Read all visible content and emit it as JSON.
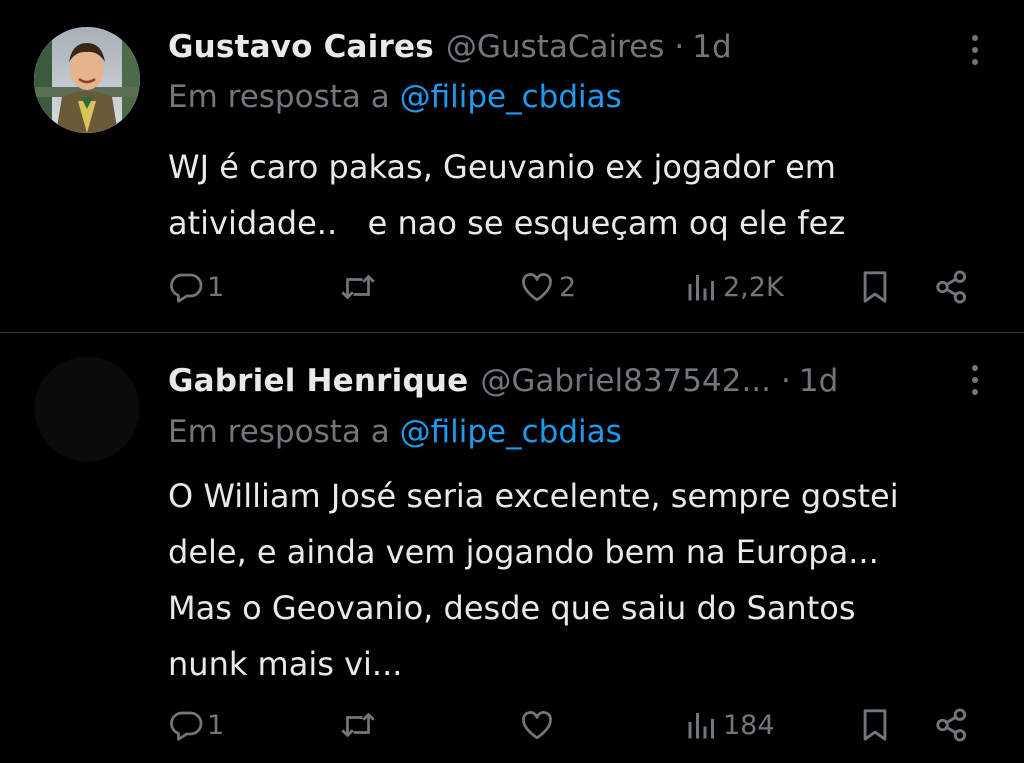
{
  "theme": {
    "background": "#000000",
    "text_primary": "#e7e9ea",
    "text_secondary": "#71767b",
    "link": "#1d9bf0",
    "divider": "#2f3336"
  },
  "tweets": [
    {
      "author_name": "Gustavo Caires",
      "handle": "@GustaCaires",
      "separator": "·",
      "time": "1d",
      "reply_prefix": "Em resposta a",
      "reply_to": "@filipe_cbdias",
      "text_lines": [
        "WJ é caro pakas, Geuvanio ex jogador em",
        "atividade..   e nao se esqueçam oq ele fez"
      ],
      "replies": "1",
      "retweets": "",
      "likes": "2",
      "views": "2,2K",
      "avatar": "profile-photo"
    },
    {
      "author_name": "Gabriel Henrique",
      "handle": "@Gabriel837542...",
      "separator": "·",
      "time": "1d",
      "reply_prefix": "Em resposta a",
      "reply_to": "@filipe_cbdias",
      "text_lines": [
        "O William José seria excelente, sempre gostei",
        "dele, e ainda vem jogando bem na Europa...",
        "Mas o Geovanio, desde que saiu do Santos",
        "nunk mais vi..."
      ],
      "replies": "1",
      "retweets": "",
      "likes": "",
      "views": "184",
      "avatar": "profile-photo-dark"
    }
  ],
  "icons": {
    "reply": "reply-icon",
    "retweet": "retweet-icon",
    "like": "heart-icon",
    "views": "views-icon",
    "bookmark": "bookmark-icon",
    "share": "share-icon",
    "more": "more-icon"
  }
}
